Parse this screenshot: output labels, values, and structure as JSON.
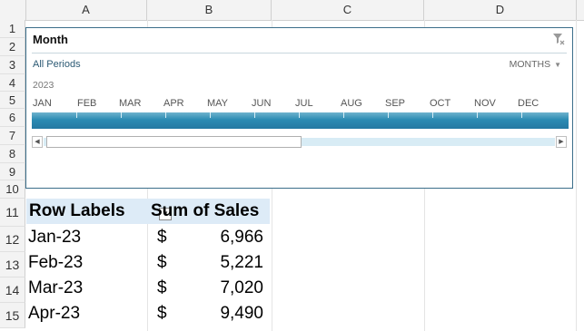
{
  "columns": [
    "A",
    "B",
    "C",
    "D"
  ],
  "rows": [
    "1",
    "2",
    "3",
    "4",
    "5",
    "6",
    "7",
    "8",
    "9",
    "10",
    "11",
    "12",
    "13",
    "14",
    "15"
  ],
  "timeline": {
    "title": "Month",
    "period_label": "All Periods",
    "time_level": "MONTHS",
    "year": "2023",
    "months": [
      "JAN",
      "FEB",
      "MAR",
      "APR",
      "MAY",
      "JUN",
      "JUL",
      "AUG",
      "SEP",
      "OCT",
      "NOV",
      "DEC"
    ]
  },
  "pivot": {
    "header_row_labels": "Row Labels",
    "header_sum": "Sum of Sales",
    "currency": "$",
    "rows": [
      {
        "label": "Jan-23",
        "value": "6,966"
      },
      {
        "label": "Feb-23",
        "value": "5,221"
      },
      {
        "label": "Mar-23",
        "value": "7,020"
      },
      {
        "label": "Apr-23",
        "value": "9,490"
      }
    ]
  }
}
